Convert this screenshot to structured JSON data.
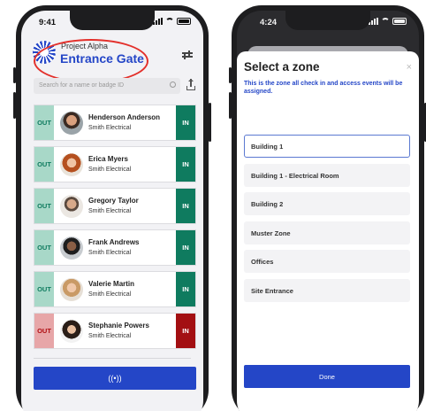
{
  "left_screen": {
    "status": {
      "time": "9:41"
    },
    "header": {
      "project": "Project Alpha",
      "site": "Entrance Gate"
    },
    "search": {
      "placeholder": "Search for a name or badge ID"
    },
    "workers": [
      {
        "name": "Henderson Anderson",
        "company": "Smith Electrical",
        "out_label": "OUT",
        "in_label": "IN",
        "status": "in"
      },
      {
        "name": "Erica Myers",
        "company": "Smith Electrical",
        "out_label": "OUT",
        "in_label": "IN",
        "status": "in"
      },
      {
        "name": "Gregory Taylor",
        "company": "Smith Electrical",
        "out_label": "OUT",
        "in_label": "IN",
        "status": "in"
      },
      {
        "name": "Frank Andrews",
        "company": "Smith Electrical",
        "out_label": "OUT",
        "in_label": "IN",
        "status": "in"
      },
      {
        "name": "Valerie Martin",
        "company": "Smith Electrical",
        "out_label": "OUT",
        "in_label": "IN",
        "status": "in"
      },
      {
        "name": "Stephanie Powers",
        "company": "Smith Electrical",
        "out_label": "OUT",
        "in_label": "IN",
        "status": "out"
      }
    ],
    "nfc_button": {
      "icon": "nfc-icon",
      "glyph": "((•))"
    }
  },
  "right_screen": {
    "status": {
      "time": "4:24"
    },
    "modal": {
      "title": "Select a zone",
      "close_glyph": "×",
      "description": "This is the zone all check in and access events will be assigned.",
      "zones": [
        "Building 1",
        "Building 1 - Electrical Room",
        "Building 2",
        "Muster Zone",
        "Offices",
        "Site Entrance"
      ],
      "selected_zone": "Building 1",
      "done_label": "Done"
    }
  },
  "colors": {
    "brand_blue": "#2446c7",
    "in_active": "#0f7b5f",
    "out_inactive": "#a8d8c8",
    "out_active": "#e7a6a8",
    "in_inactive": "#a30f12",
    "annotation": "#e3302b"
  }
}
